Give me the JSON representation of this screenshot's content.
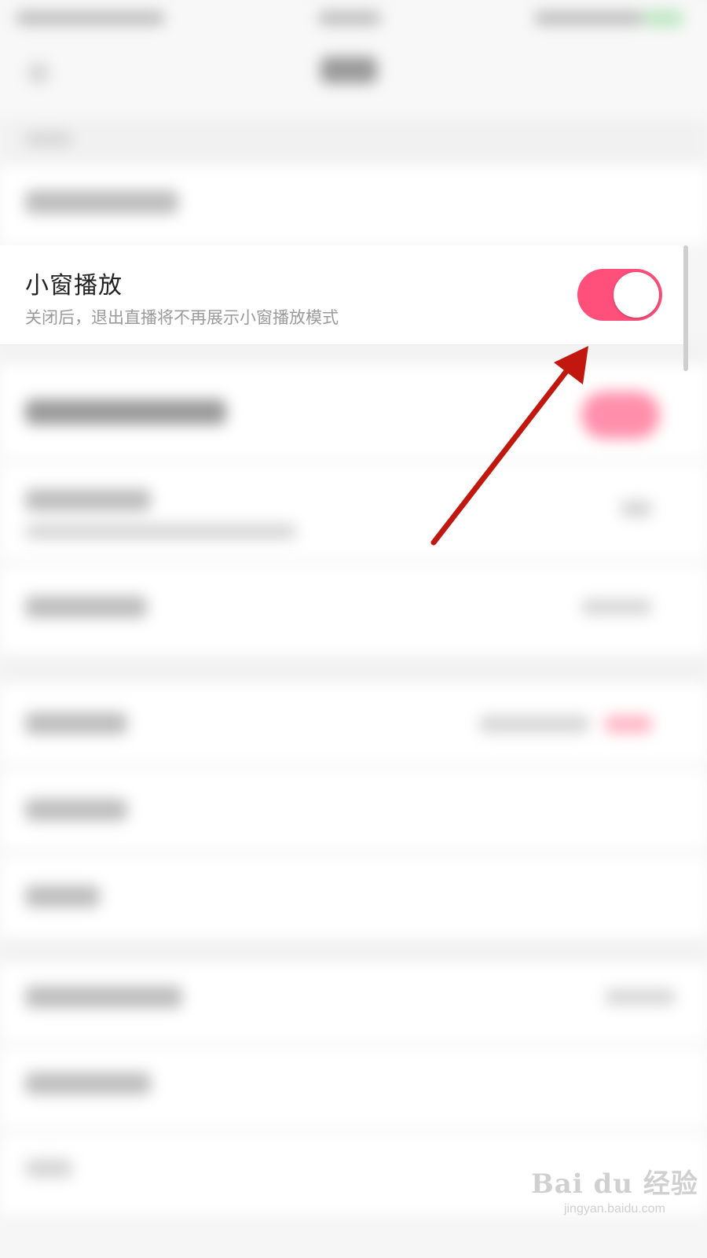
{
  "colors": {
    "accent": "#ff4f7a",
    "arrow": "#c2170f"
  },
  "setting": {
    "title": "小窗播放",
    "description": "关闭后，退出直播将不再展示小窗播放模式",
    "enabled": true
  },
  "watermark": {
    "brand": "Bai du 经验",
    "url": "jingyan.baidu.com"
  }
}
